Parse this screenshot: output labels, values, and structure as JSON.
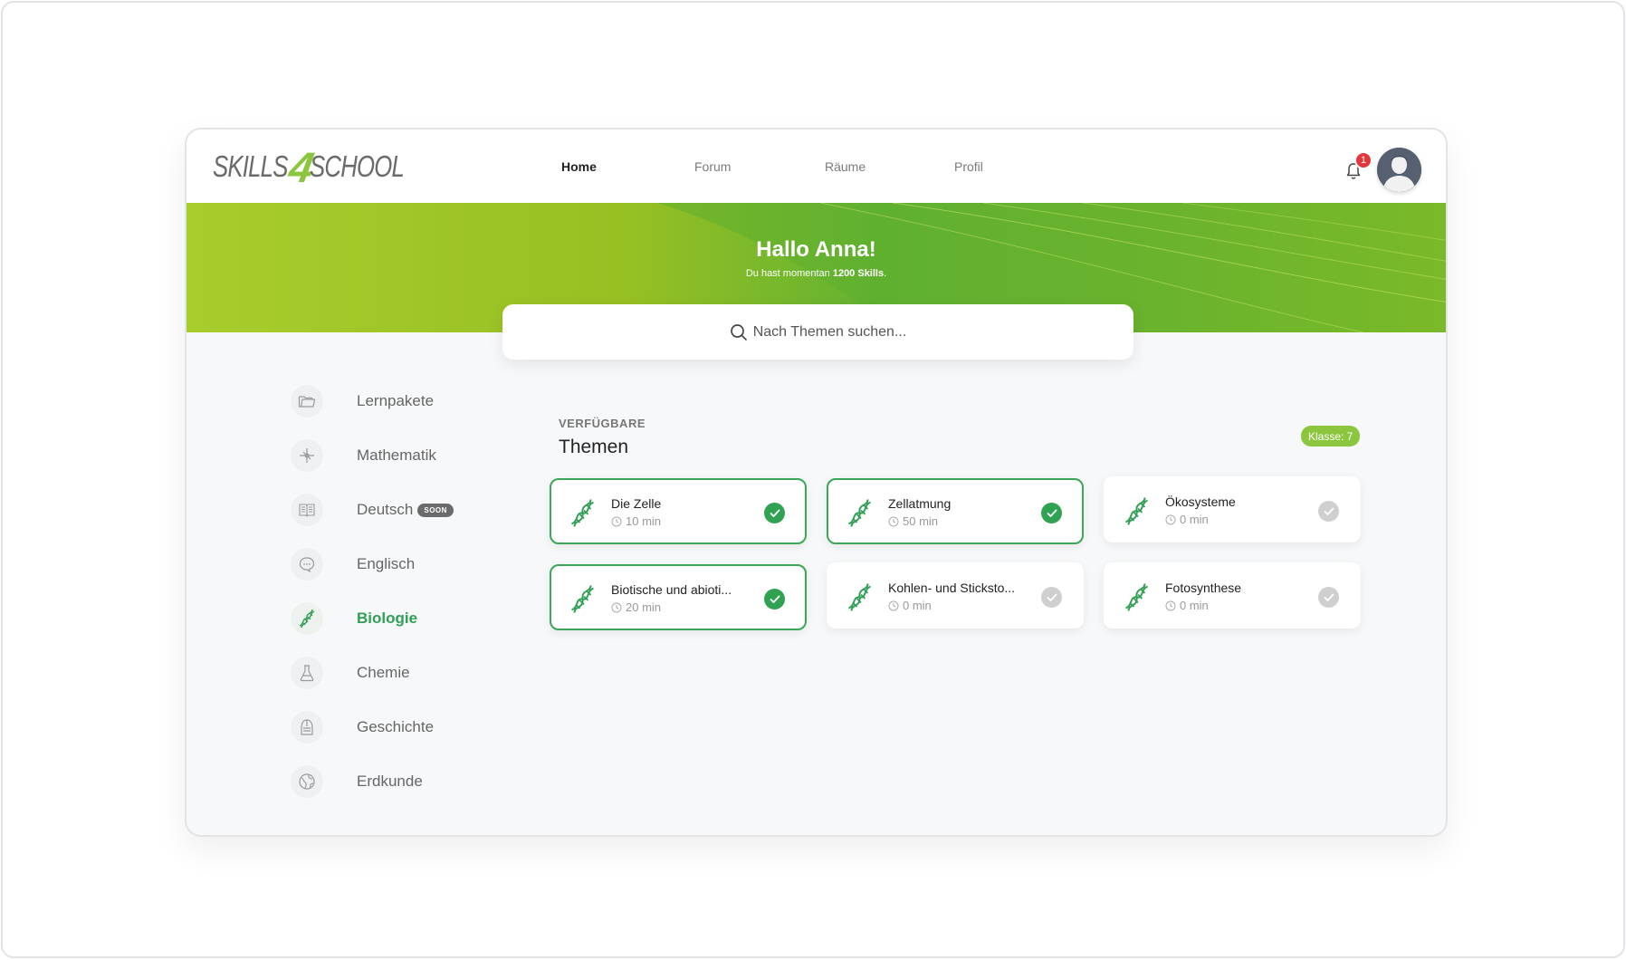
{
  "brand": {
    "part1": "SKILLS",
    "part2": "4",
    "part3": "SCHOOL"
  },
  "nav": {
    "home": "Home",
    "forum": "Forum",
    "raeume": "Räume",
    "profil": "Profil"
  },
  "notifications": {
    "count": "1"
  },
  "hero": {
    "title": "Hallo Anna!",
    "subtitle_prefix": "Du hast momentan ",
    "subtitle_bold": "1200 Skills",
    "subtitle_suffix": "."
  },
  "search": {
    "placeholder": "Nach Themen suchen..."
  },
  "sidebar": {
    "items": [
      {
        "label": "Lernpakete",
        "icon": "folder-icon"
      },
      {
        "label": "Mathematik",
        "icon": "math-icon"
      },
      {
        "label": "Deutsch",
        "icon": "book-icon",
        "badge": "SOON"
      },
      {
        "label": "Englisch",
        "icon": "speech-bubble-icon"
      },
      {
        "label": "Biologie",
        "icon": "dna-icon",
        "active": true
      },
      {
        "label": "Chemie",
        "icon": "flask-icon"
      },
      {
        "label": "Geschichte",
        "icon": "knight-helmet-icon"
      },
      {
        "label": "Erdkunde",
        "icon": "globe-icon"
      }
    ]
  },
  "content": {
    "eyebrow": "VERFÜGBARE",
    "title": "Themen",
    "grade_badge": "Klasse: 7",
    "cards": [
      {
        "title": "Die Zelle",
        "time": "10 min",
        "done": true
      },
      {
        "title": "Zellatmung",
        "time": "50 min",
        "done": true
      },
      {
        "title": "Ökosysteme",
        "time": "0 min",
        "done": false
      },
      {
        "title": "Biotische und abioti...",
        "time": "20 min",
        "done": true
      },
      {
        "title": "Kohlen- und Sticksto...",
        "time": "0 min",
        "done": false
      },
      {
        "title": "Fotosynthese",
        "time": "0 min",
        "done": false
      }
    ]
  },
  "colors": {
    "accent": "#8cc63f",
    "success": "#2fa352",
    "badge_red": "#e5373b"
  }
}
